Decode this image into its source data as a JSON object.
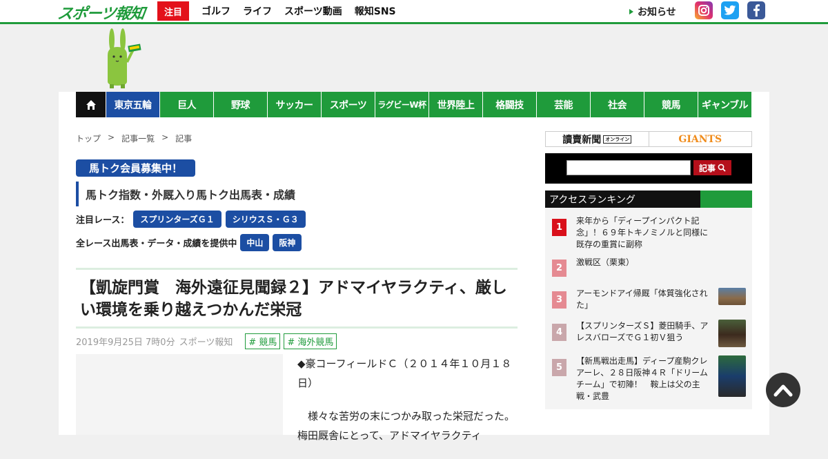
{
  "header": {
    "logo": "スポーツ報知",
    "highlight": "注目",
    "nav": [
      "ゴルフ",
      "ライフ",
      "スポーツ動画",
      "報知SNS"
    ],
    "notice": "お知らせ",
    "sns": {
      "instagram": "instagram-icon",
      "twitter": "twitter-icon",
      "facebook": "facebook-icon"
    },
    "colors": {
      "brand_green": "#1f9b3b",
      "accent_red": "#e3111a",
      "nav_blue": "#1c4ea3"
    }
  },
  "category_nav": [
    "東京五輪",
    "巨人",
    "野球",
    "サッカー",
    "スポーツ",
    "ラグビーW杯",
    "世界陸上",
    "格闘技",
    "芸能",
    "社会",
    "競馬",
    "ギャンブル"
  ],
  "breadcrumb": [
    "トップ",
    ">",
    "記事一覧",
    ">",
    "記事"
  ],
  "promo": {
    "badge": "馬トク会員募集中！",
    "subhead": "馬トク指数・外厩入り馬トク出馬表・成績",
    "race_label": "注目レース：",
    "races": [
      "スプリンターズＧ１",
      "シリウスＳ・Ｇ３"
    ],
    "all_label": "全レース出馬表・データ・成績を提供中",
    "venues": [
      "中山",
      "阪神"
    ]
  },
  "article": {
    "headline": "【凱旋門賞　海外遠征見聞録２】アドマイヤラクティ、厳しい環境を乗り越えつかんだ栄冠",
    "date": "2019年9月25日 7時0分",
    "source": "スポーツ報知",
    "tags": [
      "# 競馬",
      "# 海外競馬"
    ],
    "paragraphs": [
      "◆豪コーフィールドＣ（２０１４年１０月１８日）",
      "　様々な苦労の末につかみ取った栄冠だった。梅田厩舎にとって、アドマイヤラクティ"
    ]
  },
  "sidebar": {
    "banner_left": "讀賣新聞",
    "banner_left_sub": "オンライン",
    "banner_right": "GIANTS",
    "search_button": "記事",
    "ranking_title": "アクセスランキング",
    "ranking": [
      {
        "num": "1",
        "text": "来年から「ディープインパクト記念」！６９年トキノミノルと同様に既存の重賞に副称",
        "color": "#d9101b"
      },
      {
        "num": "2",
        "text": "激戦区（栗東）",
        "color": "#e58a92"
      },
      {
        "num": "3",
        "text": "アーモンドアイ帰厩「体質強化された」",
        "color": "#e58a92"
      },
      {
        "num": "4",
        "text": "【スプリンターズＳ】菱田騎手、アレスバローズでＧ１初Ｖ狙う",
        "color": "#c9a7ab"
      },
      {
        "num": "5",
        "text": "【新馬戦出走馬】ディープ産駒クレアーレ、２８日阪神４Ｒ「ドリームチーム」で初陣！　鞍上は父の主戦・武豊",
        "color": "#c9a7ab"
      }
    ]
  }
}
